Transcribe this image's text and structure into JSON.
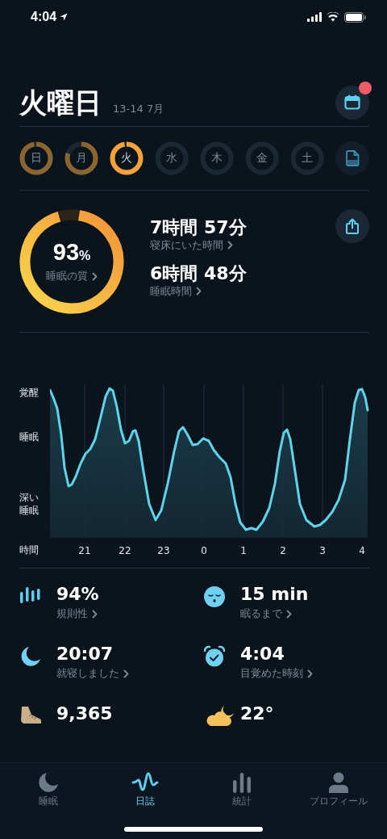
{
  "status_bar": {
    "time": "4:04"
  },
  "header": {
    "title": "火曜日",
    "date_range": "13-14 7月",
    "calendar_button": {
      "has_notification": true
    }
  },
  "days": [
    {
      "label": "日",
      "level": 0.97,
      "selected": false
    },
    {
      "label": "月",
      "level": 0.8,
      "selected": false
    },
    {
      "label": "火",
      "level": 0.97,
      "selected": true
    },
    {
      "label": "水",
      "selected": false
    },
    {
      "label": "木",
      "selected": false
    },
    {
      "label": "金",
      "selected": false
    },
    {
      "label": "土",
      "selected": false
    }
  ],
  "summary": {
    "quality": {
      "value": "93",
      "unit": "%",
      "label": "睡眠の質",
      "level": 0.93
    },
    "stats": [
      {
        "value": "7時間 57分",
        "label": "寝床にいた時間"
      },
      {
        "value": "6時間 48分",
        "label": "睡眠時間"
      }
    ]
  },
  "chart": {
    "y_labels": [
      "覚醒",
      "睡眠",
      "深い睡眠"
    ],
    "x_title": "時間",
    "x_labels": [
      "21",
      "22",
      "23",
      "0",
      "1",
      "2",
      "3",
      "4"
    ]
  },
  "metrics": [
    {
      "value": "94%",
      "label": "規則性"
    },
    {
      "value": "15 min",
      "label": "眠るまで"
    },
    {
      "value": "20:07",
      "label": "就寝しました"
    },
    {
      "value": "4:04",
      "label": "目覚めた時刻"
    },
    {
      "value": "9,365"
    },
    {
      "value": "22°"
    }
  ],
  "tabs": [
    {
      "label": "睡眠",
      "selected": false
    },
    {
      "label": "日誌",
      "selected": true
    },
    {
      "label": "統計",
      "selected": false
    },
    {
      "label": "プロフィール",
      "selected": false
    }
  ]
}
